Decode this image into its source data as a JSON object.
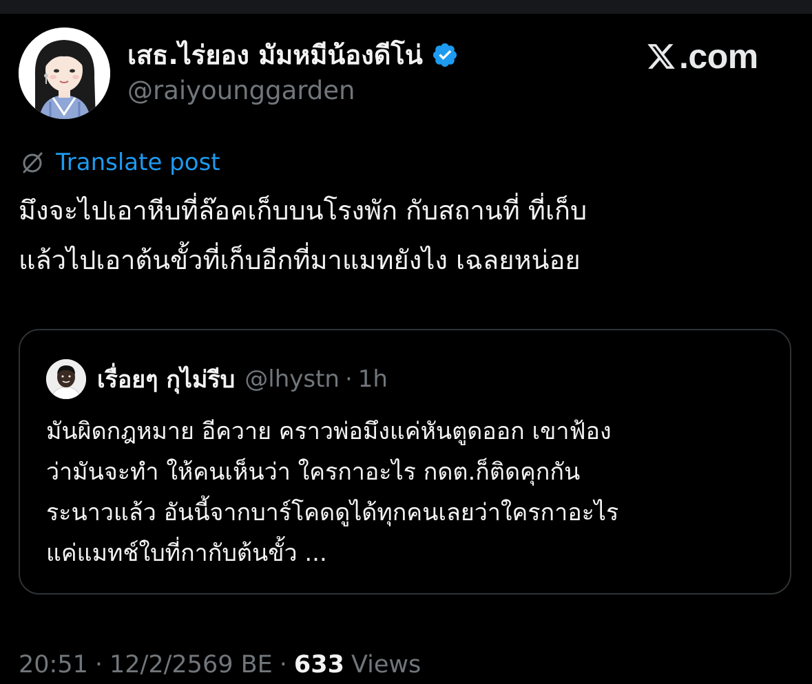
{
  "author": {
    "display_name": "เสธ.ไร่ยอง มัมหมีน้องดีโน่",
    "handle": "@raiyounggarden",
    "verified_icon": "verified-badge-icon",
    "avatar_icon": "profile-avatar"
  },
  "brand": {
    "logo_icon": "x-logo-icon",
    "text": ".com"
  },
  "translate": {
    "icon": "globe-slash-icon",
    "label": "Translate post"
  },
  "post": {
    "text": "มึงจะไปเอาหีบที่ล๊อคเก็บบนโรงพัก กับสถานที่ ที่เก็บ\nแล้วไปเอาต้นขั้วที่เก็บอีกที่มาแมทยังไง เฉลยหน่อย"
  },
  "quote": {
    "display_name": "เรื่อยๆ กุไม่รีบ",
    "handle": "@lhystn",
    "separator": "·",
    "time": "1h",
    "text": "มันผิดกฎหมาย อีควาย คราวพ่อมึงแค่หันตูดออก เขาฟ้อง\nว่ามันจะทำ ให้คนเห็นว่า ใครกาอะไร กดต.ก็ติดคุกกัน\nระนาวแล้ว อันนี้จากบาร์โคดดูได้ทุกคนเลยว่าใครกาอะไร\nแค่แมทช์ใบที่กากับต้นขั้ว ..."
  },
  "meta": {
    "time": "20:51",
    "sep1": "·",
    "date": "12/2/2569 BE",
    "sep2": "·",
    "views_count": "633",
    "views_label": "Views"
  },
  "colors": {
    "background": "#000000",
    "text": "#e7e9ea",
    "secondary": "#71767b",
    "link": "#1d9bf0",
    "border": "#2f3336",
    "verified": "#1d9bf0"
  }
}
